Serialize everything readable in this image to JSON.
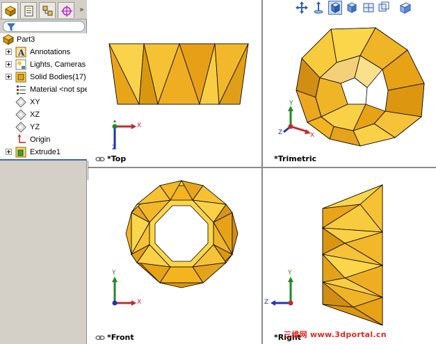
{
  "panel": {
    "collapse_glyph": "»",
    "tabs": [
      {
        "name": "feature-manager-tab",
        "icon": "feature-manager-icon",
        "active": true
      },
      {
        "name": "property-manager-tab",
        "icon": "property-manager-icon",
        "active": false
      },
      {
        "name": "configuration-manager-tab",
        "icon": "configuration-manager-icon",
        "active": false
      },
      {
        "name": "dimxpert-tab",
        "icon": "crosshair-icon",
        "active": false
      }
    ],
    "filter_icon": "filter-icon"
  },
  "tree": {
    "root": "Part3",
    "items": [
      {
        "label": "Annotations",
        "icon": "annotations-icon",
        "expandable": true
      },
      {
        "label": "Lights, Cameras",
        "icon": "lights-icon",
        "expandable": true
      },
      {
        "label": "Solid Bodies(17)",
        "icon": "solid-bodies-icon",
        "expandable": true
      },
      {
        "label": "Material <not spe",
        "icon": "material-icon",
        "expandable": false
      },
      {
        "label": "XY",
        "icon": "plane-icon",
        "expandable": false
      },
      {
        "label": "XZ",
        "icon": "plane-icon",
        "expandable": false
      },
      {
        "label": "YZ",
        "icon": "plane-icon",
        "expandable": false
      },
      {
        "label": "Origin",
        "icon": "origin-icon",
        "expandable": false
      },
      {
        "label": "Extrude1",
        "icon": "extrude-icon",
        "expandable": true
      }
    ]
  },
  "viewports": {
    "top": "*Top",
    "trimetric": "*Trimetric",
    "front": "*Front",
    "right": "*Right"
  },
  "axes": {
    "x": "X",
    "y": "Y",
    "z": "Z"
  },
  "view_toolbar": [
    "move-icon",
    "normal-to-icon",
    "display-style-icon",
    "shaded-cube-icon",
    "section-view-icon",
    "view-orientation-dropdown-icon",
    "display-mode-icon"
  ],
  "watermark": "三维网 www.3dportal.cn",
  "colors": {
    "part_fill": "#f3b41f",
    "part_light": "#fbd54a",
    "part_dark": "#d18e12",
    "edge": "#000000",
    "accent_blue": "#3c6ea5"
  }
}
